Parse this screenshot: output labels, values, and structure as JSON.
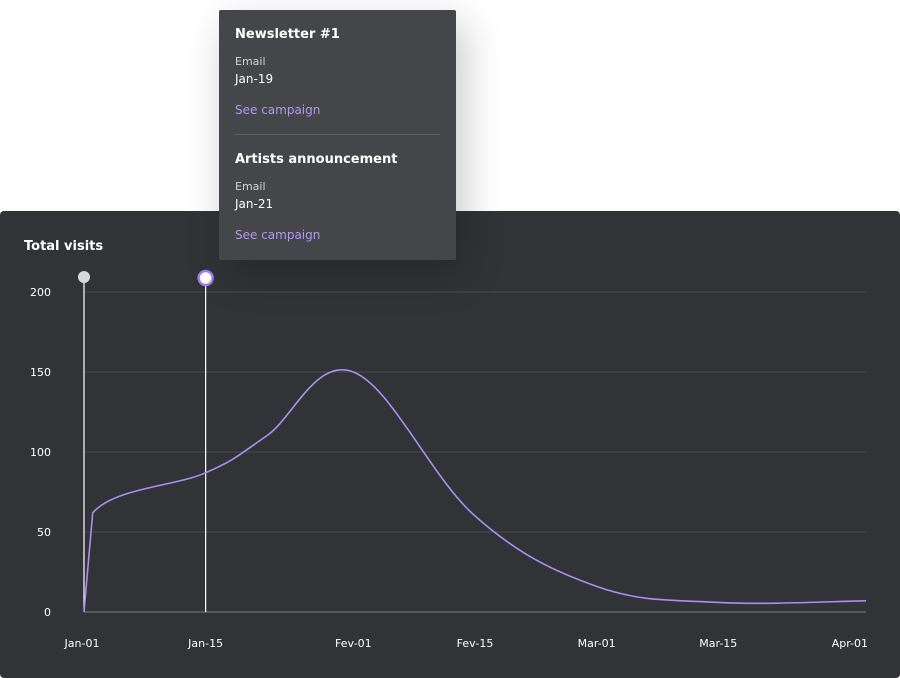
{
  "tooltip": {
    "campaigns": [
      {
        "name": "Newsletter #1",
        "type": "Email",
        "date": "Jan-19",
        "link_label": "See campaign"
      },
      {
        "name": "Artists announcement",
        "type": "Email",
        "date": "Jan-21",
        "link_label": "See campaign"
      }
    ]
  },
  "chart_data": {
    "type": "line",
    "title": "Total visits",
    "xlabel": "",
    "ylabel": "",
    "x_ticks": [
      "Jan-01",
      "Jan-15",
      "Fev-01",
      "Fev-15",
      "Mar-01",
      "Mar-15",
      "Apr-01"
    ],
    "y_ticks": [
      0,
      50,
      100,
      150,
      200
    ],
    "ylim": [
      0,
      200
    ],
    "grid": true,
    "series": [
      {
        "x": [
          "Jan-01",
          "Jan-02",
          "Jan-15",
          "Jan-22",
          "Fev-01",
          "Fev-15",
          "Mar-01",
          "Mar-15",
          "Apr-01"
        ],
        "values": [
          0,
          62,
          87,
          110,
          150,
          60,
          16,
          6,
          7
        ]
      }
    ],
    "markers": [
      {
        "x": "Jan-01",
        "style": "filled"
      },
      {
        "x": "Jan-15",
        "style": "ring"
      }
    ],
    "colors": {
      "line": "#a98ff0",
      "marker_ring": "#9b7ff0",
      "marker_filled": "#d9d9dc",
      "background": "#323336"
    }
  }
}
